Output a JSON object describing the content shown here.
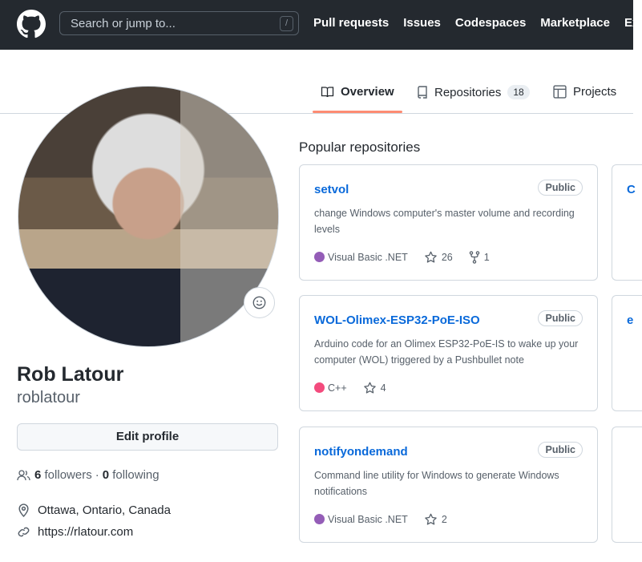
{
  "header": {
    "search_placeholder": "Search or jump to...",
    "slash_key": "/",
    "nav": [
      "Pull requests",
      "Issues",
      "Codespaces",
      "Marketplace",
      "Explore"
    ]
  },
  "tabs": [
    {
      "label": "Overview",
      "selected": true
    },
    {
      "label": "Repositories",
      "count": "18"
    },
    {
      "label": "Projects"
    }
  ],
  "profile": {
    "name": "Rob Latour",
    "login": "roblatour",
    "edit_label": "Edit profile",
    "followers": "6",
    "followers_label": "followers",
    "separator": "·",
    "following": "0",
    "following_label": "following",
    "location": "Ottawa, Ontario, Canada",
    "website": "https://rlatour.com"
  },
  "popular": {
    "heading": "Popular repositories",
    "repos": [
      {
        "name": "setvol",
        "visibility": "Public",
        "description": "change Windows computer's master volume and recording levels",
        "language": "Visual Basic .NET",
        "lang_color": "#945db7",
        "stars": "26",
        "forks": "1"
      },
      {
        "name": "WOL-Olimex-ESP32-PoE-ISO",
        "visibility": "Public",
        "description": "Arduino code for an Olimex ESP32-PoE-IS to wake up your computer (WOL) triggered by a Pushbullet note",
        "language": "C++",
        "lang_color": "#f34b7d",
        "stars": "4"
      },
      {
        "name": "notifyondemand",
        "visibility": "Public",
        "description": "Command line utility for Windows to generate Windows notifications",
        "language": "Visual Basic .NET",
        "lang_color": "#945db7",
        "stars": "2"
      }
    ],
    "partial_cards": [
      "C",
      "e",
      ""
    ]
  },
  "colors": {
    "header_bg": "#24292f",
    "link": "#0969da",
    "tab_underline": "#fd8c73"
  }
}
